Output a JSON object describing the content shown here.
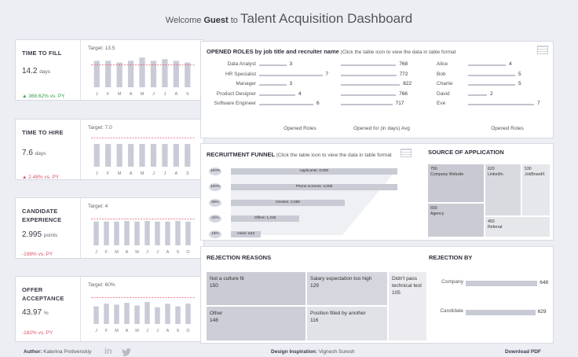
{
  "header": {
    "welcome": "Welcome",
    "guest": "Guest",
    "to": "to",
    "title": "Talent Acquisition Dashboard"
  },
  "kpis": [
    {
      "label": "TIME TO FILL",
      "value": "14.2",
      "unit": "days",
      "change": "▲ 368.62% vs. PY",
      "change_color": "#3a9a4a",
      "target": "Target: 13.5",
      "target_value": 13.5,
      "ymax": 20,
      "months": [
        "J",
        "F",
        "M",
        "A",
        "M",
        "J",
        "J",
        "A",
        "S"
      ],
      "values": [
        16,
        16,
        15,
        16,
        18,
        16,
        17,
        16,
        15
      ]
    },
    {
      "label": "TIME TO HIRE",
      "value": "7.6",
      "unit": "days",
      "change": "▲ 2.48% vs. PY",
      "change_color": "#d9546b",
      "target": "Target: 7.0",
      "target_value": 7.0,
      "ymax": 8,
      "months": [
        "J",
        "F",
        "M",
        "A",
        "M",
        "J",
        "J",
        "A",
        "S"
      ],
      "values": [
        5.5,
        5.5,
        5.5,
        5.5,
        5.5,
        5.5,
        5.5,
        5.5,
        5.5
      ]
    },
    {
      "label": "CANDIDATE EXPERIENCE",
      "value": "2.995",
      "unit": "points",
      "change": "-198% vs. PY",
      "change_color": "#d9546b",
      "target": "Target: 4",
      "target_value": 4,
      "ymax": 5,
      "months": [
        "J",
        "F",
        "M",
        "A",
        "M",
        "J",
        "J",
        "A",
        "S",
        "O"
      ],
      "values": [
        3.6,
        3.6,
        3.6,
        3.7,
        3.6,
        3.7,
        3.6,
        3.6,
        3.7,
        3.6
      ]
    },
    {
      "label": "OFFER ACCEPTANCE",
      "value": "43.97",
      "unit": "%",
      "change": "-182% vs. PY",
      "change_color": "#d9546b",
      "target": "Target: 60%",
      "target_value": 60,
      "ymax": 75,
      "months": [
        "J",
        "F",
        "M",
        "A",
        "M",
        "J",
        "J",
        "A",
        "S",
        "O"
      ],
      "values": [
        40,
        46,
        44,
        48,
        42,
        50,
        38,
        46,
        40,
        46
      ]
    }
  ],
  "roles": {
    "title": "OPENED ROLES by job title and recruiter name",
    "note": "|Click the table icon to view the data in table format",
    "job_titles": [
      "Data Analyst",
      "HR Specialist",
      "Manager",
      "Product Designer",
      "Software Engineer"
    ],
    "opened": [
      3,
      7,
      3,
      4,
      6
    ],
    "days": [
      768,
      772,
      822,
      766,
      717
    ],
    "recruiters": [
      "Alice",
      "Bob",
      "Charlie",
      "David",
      "Eve"
    ],
    "recruiter_opened": [
      4,
      5,
      5,
      2,
      7
    ],
    "axis1": "Opened Roles",
    "axis2": "Opened for (in days) Avg",
    "axis3": "Opened Roles"
  },
  "funnel": {
    "title": "RECRUITMENT FUNNEL",
    "note": "|Click the table icon to view the data in table format",
    "stages": [
      {
        "label": "Applicants: 3,000",
        "pct": "100%",
        "value": 3000
      },
      {
        "label": "Phone screens: 3,006",
        "pct": "100%",
        "value": 3006
      },
      {
        "label": "Onsites: 2,056",
        "pct": "69%",
        "value": 2056
      },
      {
        "label": "Offers: 1,235",
        "pct": "41%",
        "value": 1235
      },
      {
        "label": "Hires: 543",
        "pct": "18%",
        "value": 543
      }
    ]
  },
  "source": {
    "title": "SOURCE OF APPLICATION",
    "items": [
      {
        "value": "750",
        "name": "Company Website"
      },
      {
        "value": "650",
        "name": "Agency"
      },
      {
        "value": "620",
        "name": "LinkedIn"
      },
      {
        "value": "530",
        "name": "JobBoardX"
      },
      {
        "value": "450",
        "name": "Referral"
      }
    ]
  },
  "rejection": {
    "title": "REJECTION REASONS",
    "items": [
      {
        "name": "Not a culture fit",
        "value": "150"
      },
      {
        "name": "Salary expectation too high",
        "value": "129"
      },
      {
        "name": "Didn't pass technical test",
        "value": "105"
      },
      {
        "name": "Other",
        "value": "148"
      },
      {
        "name": "Position filled by another",
        "value": "116"
      }
    ]
  },
  "rejection_by": {
    "title": "REJECTION BY",
    "items": [
      {
        "name": "Company",
        "value": 648
      },
      {
        "name": "Candidate",
        "value": 629
      }
    ]
  },
  "footer": {
    "author_label": "Author:",
    "author": "Katerina Protivenskiy",
    "design_label": "Design Inspiration:",
    "design": "Vignesh Suresh",
    "download": "Download PDF"
  },
  "colors": {
    "bar": "#c9cbd6",
    "target": "#e8546e",
    "accent_green": "#3a9a4a",
    "accent_red": "#d9546b"
  }
}
